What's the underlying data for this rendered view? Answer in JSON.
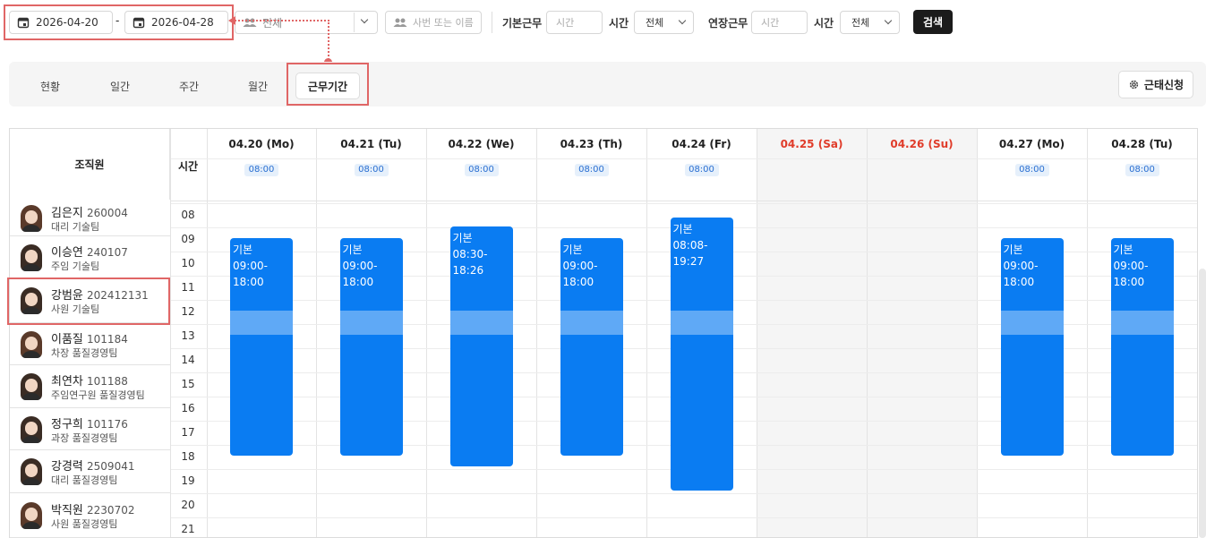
{
  "filters": {
    "date_start": "2026-04-20",
    "date_sep": "-",
    "date_end": "2026-04-28",
    "org_select": "전체",
    "employee_placeholder": "사번 또는 이름",
    "basic_work_label": "기본근무",
    "basic_time_placeholder": "시간",
    "basic_time_label": "시간",
    "basic_select": "전체",
    "overtime_label": "연장근무",
    "overtime_time_placeholder": "시간",
    "overtime_time_label": "시간",
    "overtime_select": "전체",
    "search_button": "검색"
  },
  "tabs": [
    "현황",
    "일간",
    "주간",
    "월간",
    "근무기간"
  ],
  "active_tab": "근무기간",
  "leave_request_button": "근태신청",
  "grid": {
    "members_header": "조직원",
    "time_header": "시간",
    "days": [
      {
        "label": "04.20 (Mo)",
        "time": "08:00",
        "weekend": false
      },
      {
        "label": "04.21 (Tu)",
        "time": "08:00",
        "weekend": false
      },
      {
        "label": "04.22 (We)",
        "time": "08:00",
        "weekend": false
      },
      {
        "label": "04.23 (Th)",
        "time": "08:00",
        "weekend": false
      },
      {
        "label": "04.24 (Fr)",
        "time": "08:00",
        "weekend": false
      },
      {
        "label": "04.25 (Sa)",
        "time": "",
        "weekend": true
      },
      {
        "label": "04.26 (Su)",
        "time": "",
        "weekend": true
      },
      {
        "label": "04.27 (Mo)",
        "time": "08:00",
        "weekend": false
      },
      {
        "label": "04.28 (Tu)",
        "time": "08:00",
        "weekend": false
      }
    ],
    "hours": [
      "08",
      "09",
      "10",
      "11",
      "12",
      "13",
      "14",
      "15",
      "16",
      "17",
      "18",
      "19",
      "20",
      "21"
    ],
    "shifts": [
      {
        "day": 0,
        "label": "기본 09:00-18:00",
        "start": 9.0,
        "end": 18.0
      },
      {
        "day": 1,
        "label": "기본 09:00-18:00",
        "start": 9.0,
        "end": 18.0
      },
      {
        "day": 2,
        "label": "기본 08:30-18:26",
        "start": 8.5,
        "end": 18.43
      },
      {
        "day": 3,
        "label": "기본 09:00-18:00",
        "start": 9.0,
        "end": 18.0
      },
      {
        "day": 4,
        "label": "기본 08:08-19:27",
        "start": 8.13,
        "end": 19.45
      },
      {
        "day": 7,
        "label": "기본 09:00-18:00",
        "start": 9.0,
        "end": 18.0
      },
      {
        "day": 8,
        "label": "기본 09:00-18:00",
        "start": 9.0,
        "end": 18.0
      }
    ],
    "lunch": {
      "start": 12,
      "end": 13
    }
  },
  "employees": [
    {
      "name": "김은지",
      "id": "260004",
      "dept": "대리 기술팀",
      "gender": "f"
    },
    {
      "name": "이승연",
      "id": "240107",
      "dept": "주임 기술팀",
      "gender": "m"
    },
    {
      "name": "강범윤",
      "id": "202412131",
      "dept": "사원 기술팀",
      "gender": "m"
    },
    {
      "name": "이품질",
      "id": "101184",
      "dept": "차장 품질경영팀",
      "gender": "f"
    },
    {
      "name": "최연차",
      "id": "101188",
      "dept": "주임연구원 품질경영팀",
      "gender": "m"
    },
    {
      "name": "정구희",
      "id": "101176",
      "dept": "과장 품질경영팀",
      "gender": "m"
    },
    {
      "name": "강경력",
      "id": "2509041",
      "dept": "대리 품질경영팀",
      "gender": "m"
    },
    {
      "name": "박직원",
      "id": "2230702",
      "dept": "사원 품질경영팀",
      "gender": "f"
    }
  ],
  "colors": {
    "accent": "#0a7cf2",
    "weekend_text": "#e03c2a",
    "highlight": "#e06666"
  },
  "icons": [
    "calendar-icon",
    "people-icon",
    "chevron-down-icon",
    "gear-icon"
  ]
}
